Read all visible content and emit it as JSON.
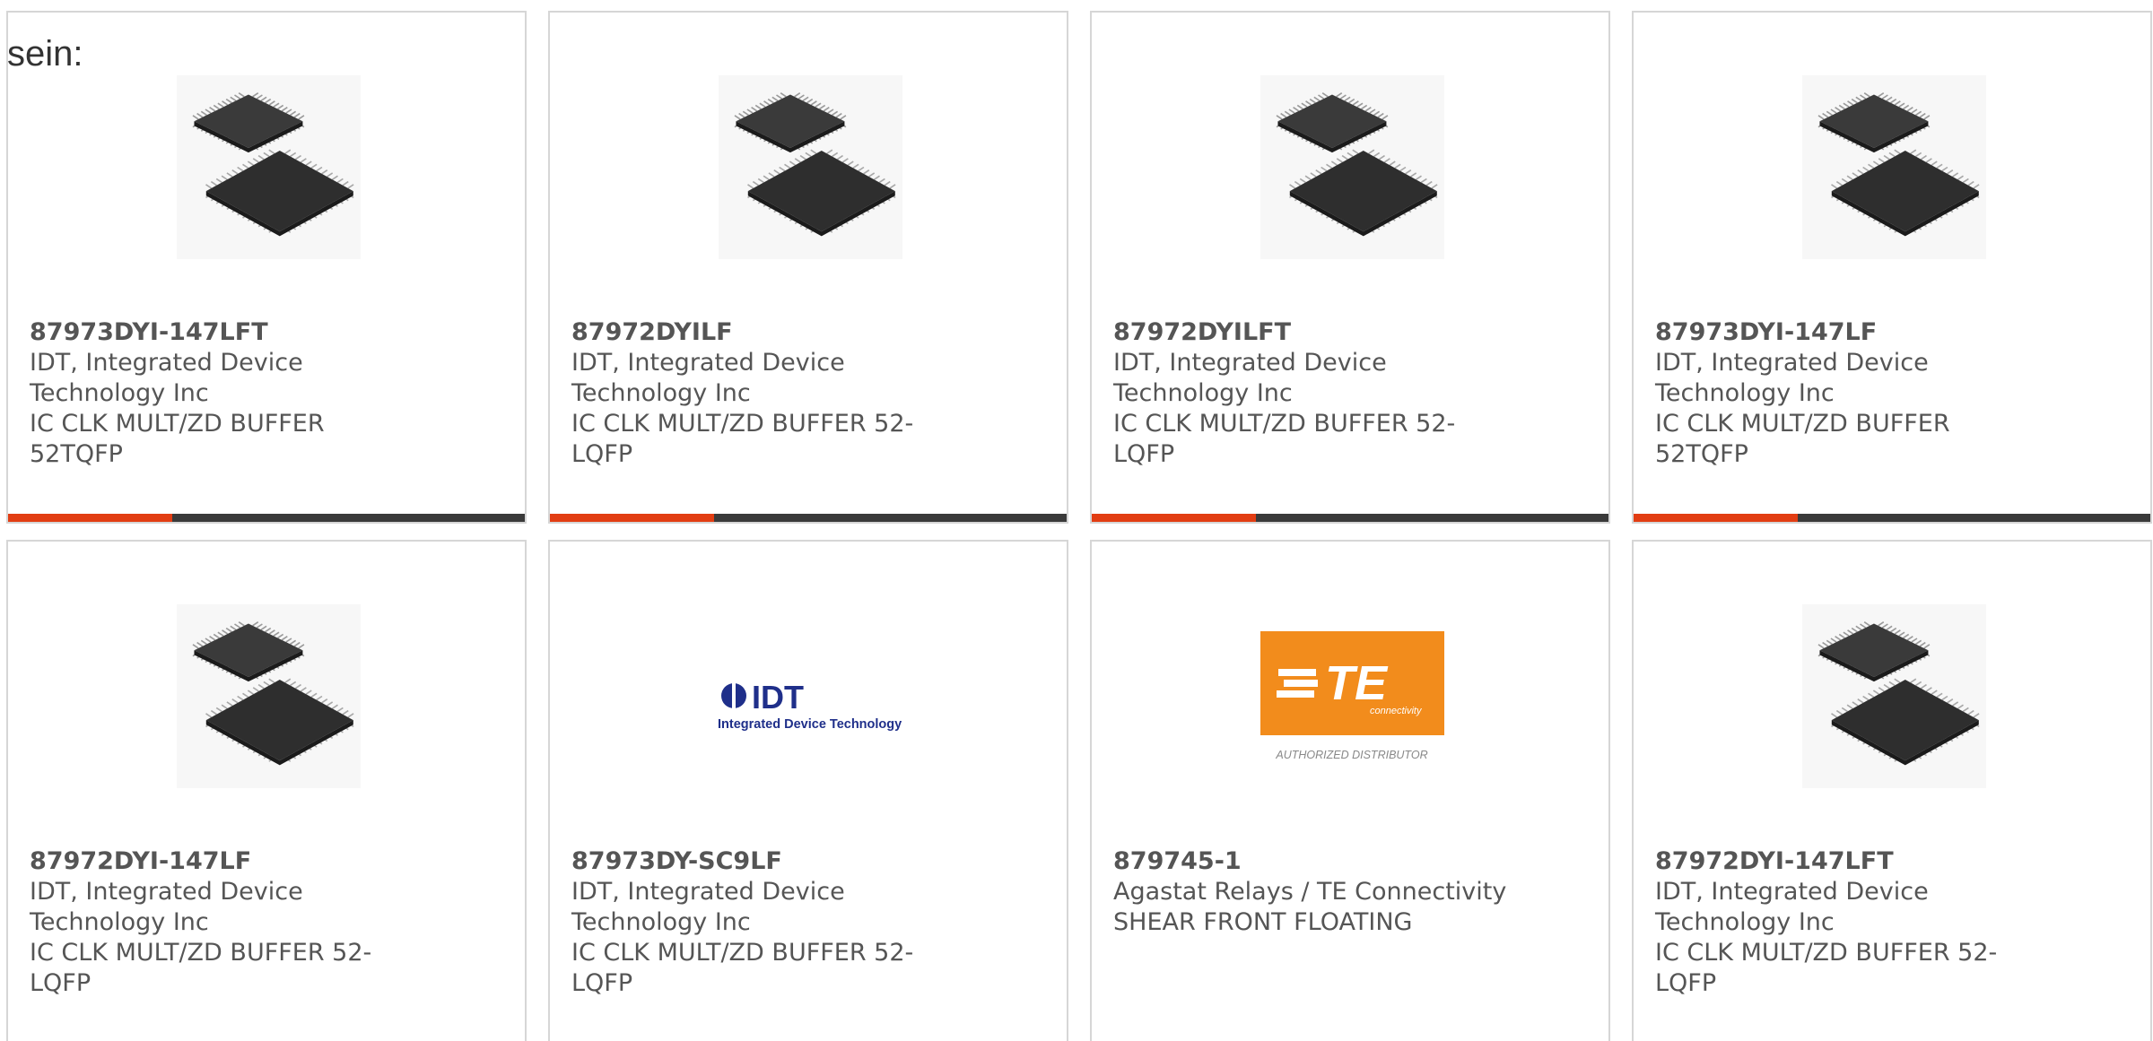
{
  "intro_text": "sein:",
  "colors": {
    "accent": "#e23d13",
    "bar": "#3a3a3a",
    "text": "#555555",
    "card_border": "#d6d6d6"
  },
  "products": [
    {
      "part_number": "87973DYI-147LFT",
      "manufacturer": "IDT, Integrated Device Technology Inc",
      "description": "IC CLK MULT/ZD BUFFER 52TQFP",
      "image": "qfp-chip-image"
    },
    {
      "part_number": "87972DYILF",
      "manufacturer": "IDT, Integrated Device Technology Inc",
      "description": "IC CLK MULT/ZD BUFFER 52-LQFP",
      "image": "qfp-chip-image"
    },
    {
      "part_number": "87972DYILFT",
      "manufacturer": "IDT, Integrated Device Technology Inc",
      "description": "IC CLK MULT/ZD BUFFER 52-LQFP",
      "image": "qfp-chip-image"
    },
    {
      "part_number": "87973DYI-147LF",
      "manufacturer": "IDT, Integrated Device Technology Inc",
      "description": "IC CLK MULT/ZD BUFFER 52TQFP",
      "image": "qfp-chip-image"
    },
    {
      "part_number": "87972DYI-147LF",
      "manufacturer": "IDT, Integrated Device Technology Inc",
      "description": "IC CLK MULT/ZD BUFFER 52-LQFP",
      "image": "qfp-chip-image"
    },
    {
      "part_number": "87973DY-SC9LF",
      "manufacturer": "IDT, Integrated Device Technology Inc",
      "description": "IC CLK MULT/ZD BUFFER 52-LQFP",
      "image": "idt-logo",
      "logo_text": "IDT",
      "logo_tagline": "Integrated Device Technology"
    },
    {
      "part_number": "879745-1",
      "manufacturer": "Agastat Relays / TE Connectivity",
      "description": "SHEAR FRONT FLOATING",
      "image": "te-connectivity-logo",
      "logo_text": "TE",
      "logo_subtext": "connectivity",
      "logo_caption": "AUTHORIZED DISTRIBUTOR"
    },
    {
      "part_number": "87972DYI-147LFT",
      "manufacturer": "IDT, Integrated Device Technology Inc",
      "description": "IC CLK MULT/ZD BUFFER 52-LQFP",
      "image": "qfp-chip-image"
    }
  ]
}
